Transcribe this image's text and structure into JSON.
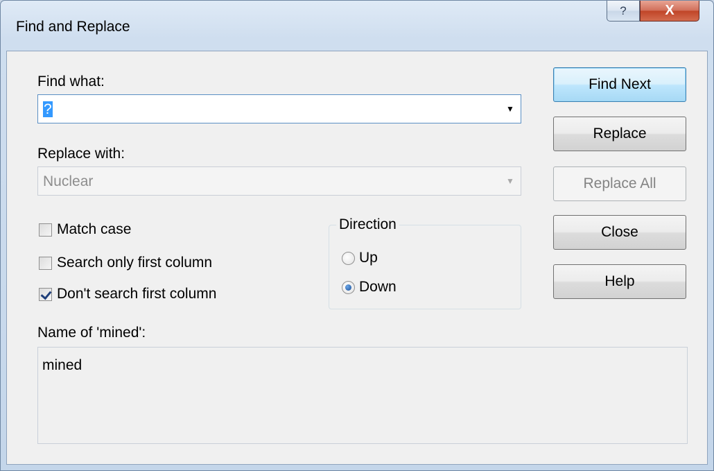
{
  "window": {
    "title": "Find and Replace",
    "help_glyph": "?",
    "close_glyph": "X"
  },
  "find": {
    "label": "Find what:",
    "value": "?"
  },
  "replace": {
    "label": "Replace with:",
    "value": "Nuclear"
  },
  "options": {
    "match_case": {
      "label": "Match case",
      "checked": false
    },
    "search_first_column": {
      "label": "Search only first column",
      "checked": false
    },
    "dont_search_first_column": {
      "label": "Don't search first column",
      "checked": true
    }
  },
  "direction": {
    "title": "Direction",
    "up": {
      "label": "Up",
      "selected": false
    },
    "down": {
      "label": "Down",
      "selected": true
    }
  },
  "buttons": {
    "find_next": "Find Next",
    "replace": "Replace",
    "replace_all": "Replace All",
    "close": "Close",
    "help": "Help"
  },
  "name_section": {
    "label": "Name of 'mined':",
    "value": "mined"
  },
  "icons": {
    "dropdown": "chevron-down-icon",
    "checkbox_check": "check-icon",
    "radio_dot": "radio-dot-icon"
  }
}
